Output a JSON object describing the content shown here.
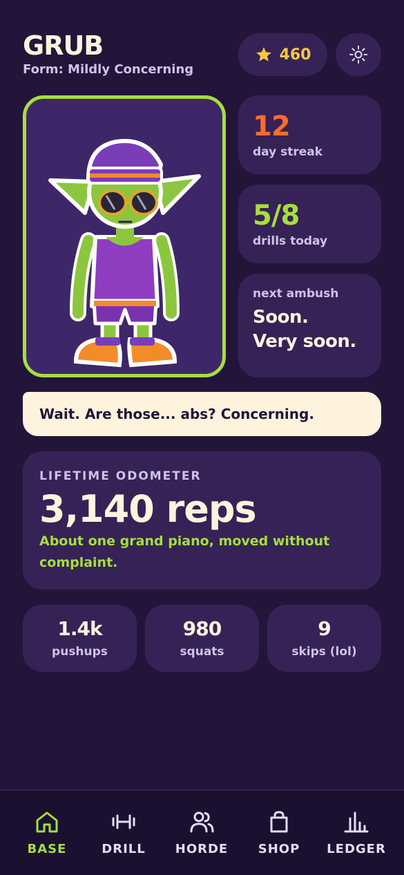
{
  "header": {
    "title": "GRUB",
    "subtitle": "Form: Mildly Concerning",
    "coins": "460"
  },
  "stats": {
    "streak_value": "12",
    "streak_label": "day streak",
    "drills_value": "5/8",
    "drills_label": "drills today",
    "ambush_label": "next ambush",
    "ambush_line1": "Soon.",
    "ambush_line2": "Very soon."
  },
  "speech": "Wait. Are those... abs? Concerning.",
  "odometer": {
    "label": "LIFETIME ODOMETER",
    "value": "3,140 reps",
    "note": "About one grand piano, moved without complaint."
  },
  "mini_stats": [
    {
      "value": "1.4k",
      "label": "pushups"
    },
    {
      "value": "980",
      "label": "squats"
    },
    {
      "value": "9",
      "label": "skips (lol)"
    }
  ],
  "nav": [
    {
      "label": "BASE",
      "icon": "home-icon",
      "active": true
    },
    {
      "label": "DRILL",
      "icon": "dumbbell-icon",
      "active": false
    },
    {
      "label": "HORDE",
      "icon": "users-icon",
      "active": false
    },
    {
      "label": "SHOP",
      "icon": "shopping-bag-icon",
      "active": false
    },
    {
      "label": "LEDGER",
      "icon": "bar-chart-icon",
      "active": false
    }
  ],
  "colors": {
    "background": "#231539",
    "card": "#362256",
    "accent_green": "#A6DE3F",
    "accent_orange": "#FF6B2C",
    "coin_gold": "#F6C845",
    "cream": "#FFF3DE"
  }
}
